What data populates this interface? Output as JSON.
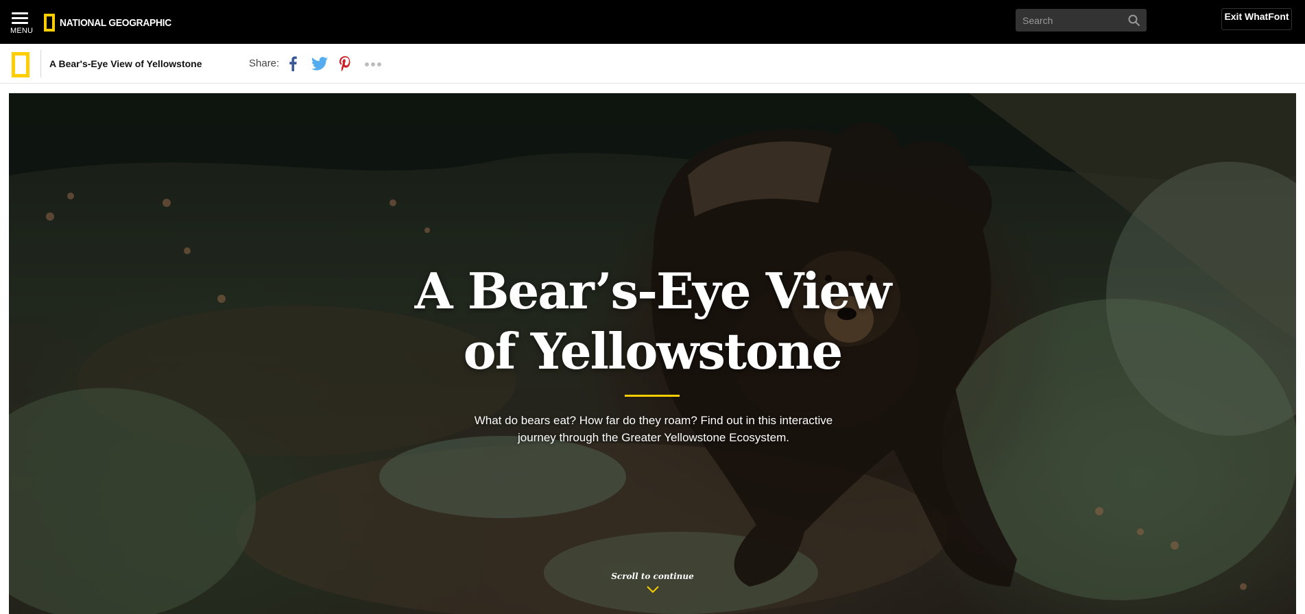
{
  "topbar": {
    "menu_label": "MENU",
    "logo_text": "NATIONAL GEOGRAPHIC",
    "search_placeholder": "Search",
    "exit_label": "Exit WhatFont"
  },
  "subbar": {
    "title": "A Bear's-Eye View of Yellowstone",
    "share_label": "Share:"
  },
  "hero": {
    "title_line1": "A Bear’s-Eye View",
    "title_line2": "of Yellowstone",
    "dek_line1": "What do bears eat? How far do they roam? Find out in this interactive",
    "dek_line2": "journey through the Greater Yellowstone Ecosystem.",
    "scroll_label": "Scroll to continue"
  },
  "colors": {
    "accent": "#ffce00",
    "facebook": "#3b5998",
    "twitter": "#55acee",
    "pinterest": "#cb2027",
    "topbar_bg": "#000000",
    "search_bg": "#333333"
  },
  "icons": {
    "menu": "hamburger-icon",
    "search": "search-icon",
    "facebook": "facebook-icon",
    "twitter": "twitter-icon",
    "pinterest": "pinterest-icon",
    "more": "more-dots-icon",
    "scroll": "chevron-down-icon"
  }
}
